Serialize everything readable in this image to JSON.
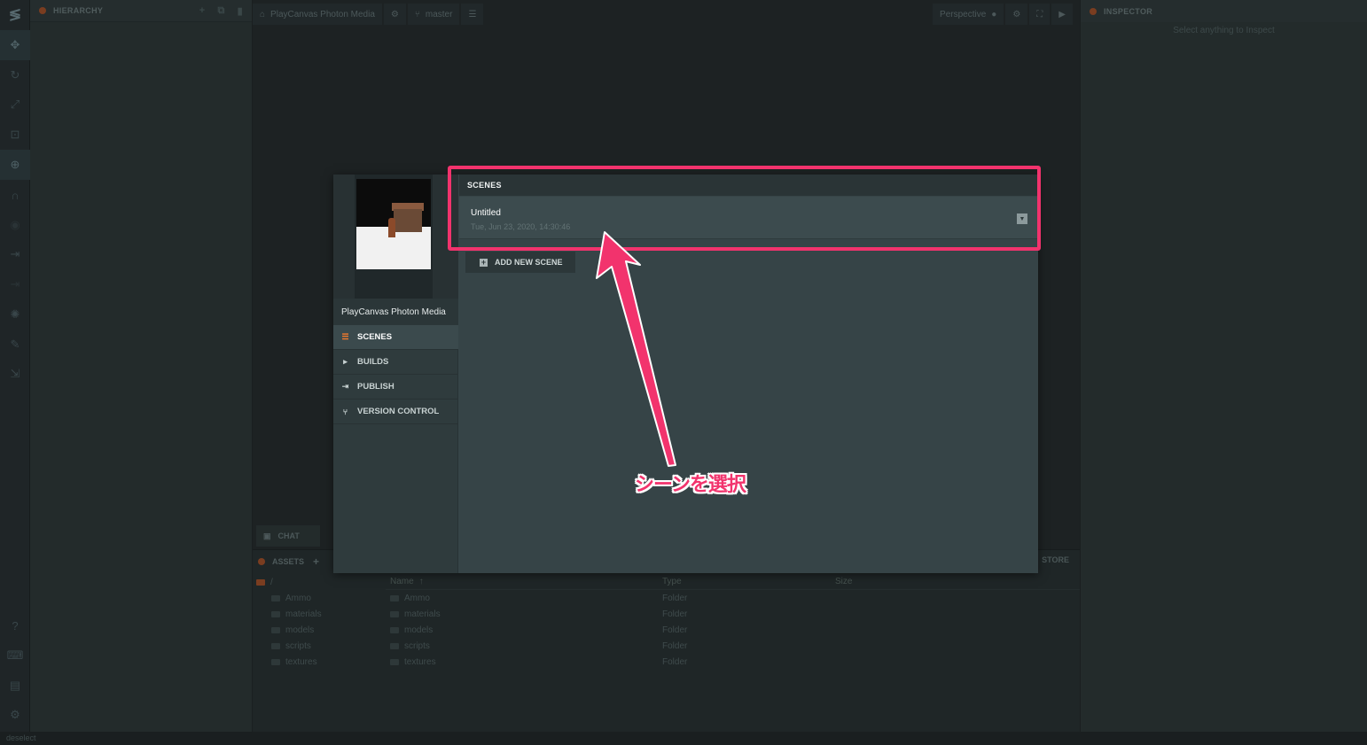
{
  "toolbar": {
    "icons": [
      "playcanvas-logo-icon",
      "translate-icon",
      "rotate-icon",
      "scale-icon",
      "resize-icon",
      "world-icon",
      "magnet-icon",
      "eye-icon",
      "launch-icon",
      "launch-alt-icon",
      "light-icon",
      "code-editor-icon",
      "publish-icon",
      "help-icon",
      "keyboard-icon",
      "chat-icon",
      "settings-icon"
    ]
  },
  "hierarchy": {
    "title": "HIERARCHY"
  },
  "viewport": {
    "project_label": "PlayCanvas Photon Media",
    "branch_label": "master",
    "camera_label": "Perspective",
    "chat_label": "CHAT"
  },
  "inspector": {
    "title": "INSPECTOR",
    "empty_text": "Select anything to Inspect"
  },
  "assets": {
    "title": "ASSETS",
    "store_label": "STORE",
    "root": "/",
    "tree": [
      "Ammo",
      "materials",
      "models",
      "scripts",
      "textures"
    ],
    "columns": {
      "name": "Name",
      "type": "Type",
      "size": "Size"
    },
    "rows": [
      {
        "name": "Ammo",
        "type": "Folder"
      },
      {
        "name": "materials",
        "type": "Folder"
      },
      {
        "name": "models",
        "type": "Folder"
      },
      {
        "name": "scripts",
        "type": "Folder"
      },
      {
        "name": "textures",
        "type": "Folder"
      }
    ]
  },
  "statusbar": {
    "text": "deselect"
  },
  "modal": {
    "project_name": "PlayCanvas Photon Media",
    "nav": [
      {
        "label": "SCENES",
        "icon": "list-icon",
        "active": true
      },
      {
        "label": "BUILDS",
        "icon": "caret-right-icon",
        "active": false
      },
      {
        "label": "PUBLISH",
        "icon": "publish-icon",
        "active": false
      },
      {
        "label": "VERSION CONTROL",
        "icon": "branch-icon",
        "active": false
      }
    ],
    "scenes_header": "SCENES",
    "scene": {
      "name": "Untitled",
      "date": "Tue, Jun 23, 2020, 14:30:46"
    },
    "add_scene_label": "ADD NEW SCENE"
  },
  "annotation": {
    "callout": "シーンを選択",
    "color": "#f2336d"
  },
  "colors": {
    "accent": "#f27a2c",
    "annotation": "#f2336d"
  }
}
